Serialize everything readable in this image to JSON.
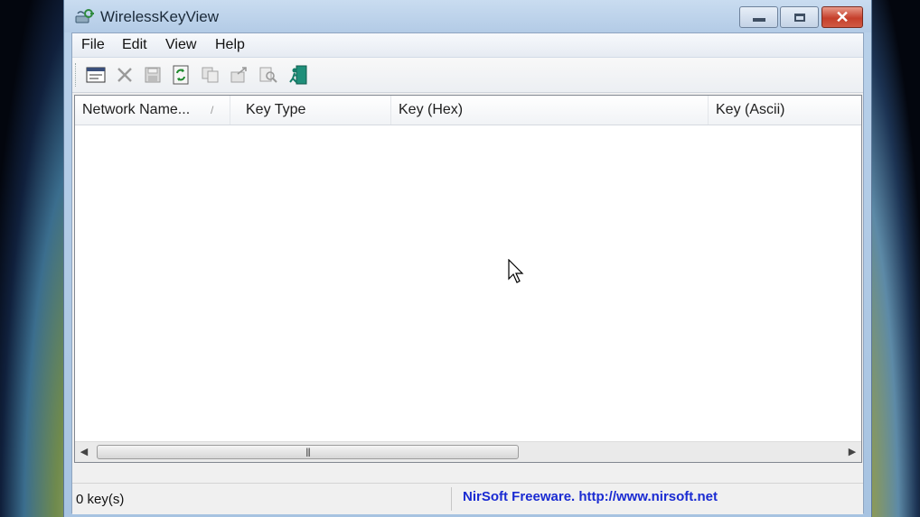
{
  "window": {
    "title": "WirelessKeyView",
    "app_icon": "wireless-key-icon",
    "controls": {
      "minimize": "minimize-icon",
      "maximize": "maximize-icon",
      "close": "close-icon",
      "close_glyph": "✕"
    }
  },
  "menu": {
    "items": [
      "File",
      "Edit",
      "View",
      "Help"
    ]
  },
  "toolbar": {
    "buttons": [
      {
        "name": "properties-icon",
        "enabled": true
      },
      {
        "name": "delete-icon",
        "enabled": false
      },
      {
        "name": "save-icon",
        "enabled": false
      },
      {
        "name": "refresh-icon",
        "enabled": true
      },
      {
        "name": "copy-icon",
        "enabled": false
      },
      {
        "name": "export-icon",
        "enabled": false
      },
      {
        "name": "find-icon",
        "enabled": false
      },
      {
        "name": "exit-icon",
        "enabled": true
      }
    ]
  },
  "list": {
    "columns": [
      "Network Name...",
      "Key Type",
      "Key (Hex)",
      "Key (Ascii)"
    ],
    "sort_indicator": "/",
    "rows": [],
    "scrollbar": {
      "left_arrow": "◀",
      "right_arrow": "▶",
      "grip": "|||"
    }
  },
  "status": {
    "count": "0 key(s)",
    "credit": "NirSoft Freeware.  http://www.nirsoft.net"
  },
  "colors": {
    "link": "#1a2bd2",
    "title_bar": "#b9d1ea",
    "close_button": "#c53f2b"
  }
}
